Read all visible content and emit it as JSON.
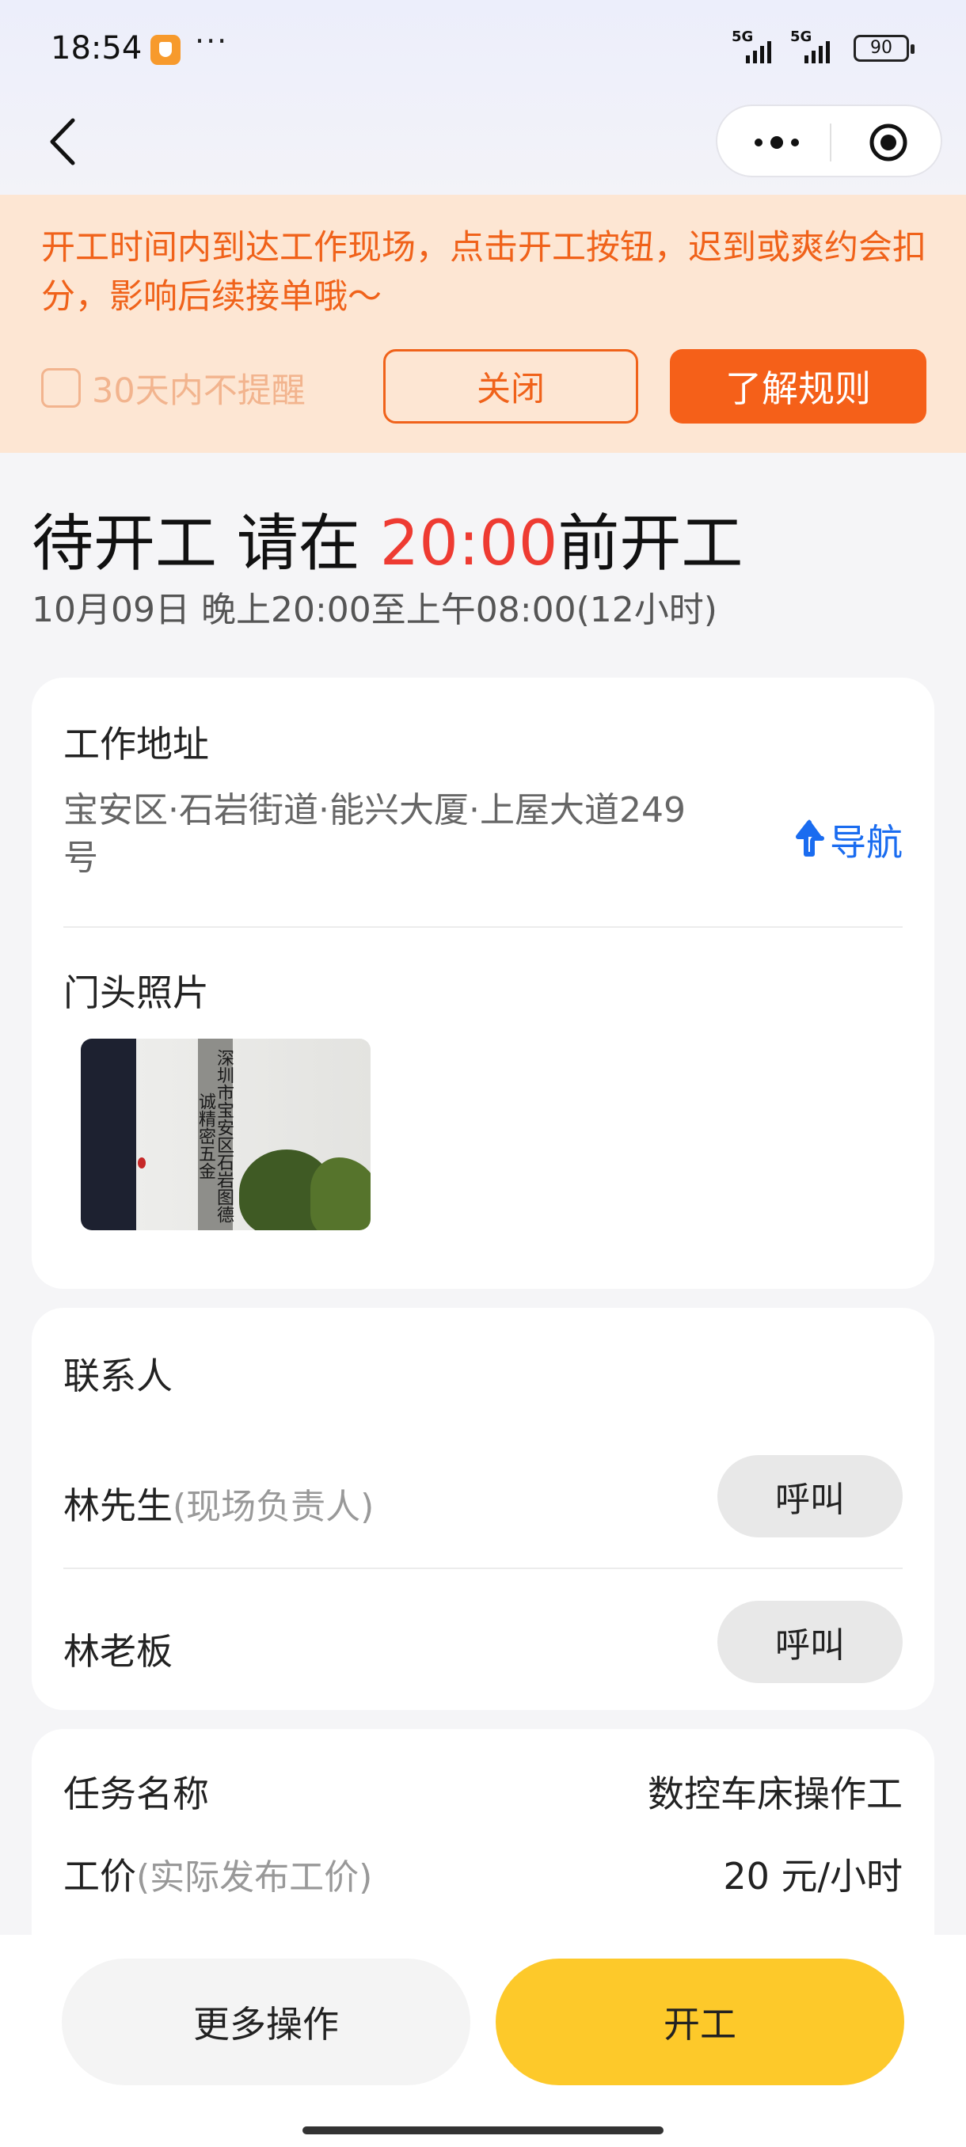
{
  "status_bar": {
    "time": "18:54",
    "dots": "···",
    "network_1": "5G",
    "network_2": "5G",
    "battery": "90"
  },
  "notice": {
    "text": "开工时间内到达工作现场，点击开工按钮，迟到或爽约会扣分，影响后续接单哦～",
    "remind_label": "30天内不提醒",
    "remind_checked": false,
    "close_label": "关闭",
    "rules_label": "了解规则",
    "accent_color": "#f0621a",
    "background_color": "#fde6d3"
  },
  "heading": {
    "status": "待开工 请在 ",
    "deadline": "20:00",
    "suffix": "前开工",
    "schedule": "10月09日  晚上20:00至上午08:00(12小时)"
  },
  "address_card": {
    "title": "工作地址",
    "address": "宝安区·石岩街道·能兴大厦·上屋大道249号",
    "nav_label": "导航",
    "photo_title": "门头照片",
    "photo_sign_text": "深圳市宝安区石岩图德诚精密五金"
  },
  "contacts_card": {
    "title": "联系人",
    "contacts": [
      {
        "name": "林先生",
        "role": "(现场负责人)",
        "call_label": "呼叫"
      },
      {
        "name": "林老板",
        "role": "",
        "call_label": "呼叫"
      }
    ]
  },
  "task_card": {
    "task_label": "任务名称",
    "task_value": "数控车床操作工",
    "wage_label": "工价",
    "wage_hint": "(实际发布工价)",
    "wage_value": "20 元/小时"
  },
  "bottom_bar": {
    "more_label": "更多操作",
    "start_label": "开工",
    "start_color": "#fdc92a"
  },
  "icons": [
    "back-arrow-icon",
    "more-dots-icon",
    "close-target-icon",
    "navigation-arrow-icon",
    "checkbox-icon",
    "app-shield-icon"
  ]
}
